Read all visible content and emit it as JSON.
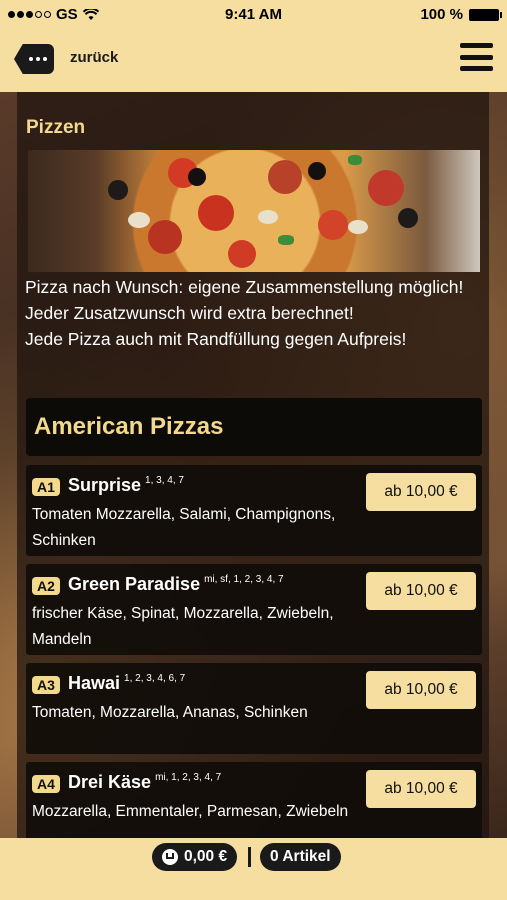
{
  "status": {
    "carrier": "GS",
    "time": "9:41 AM",
    "battery": "100 %"
  },
  "header": {
    "back_label": "zurück"
  },
  "section": {
    "title": "Pizzen",
    "intro": [
      "Pizza nach Wunsch: eigene Zusammenstellung möglich!",
      "Jeder Zusatzwunsch wird extra berechnet!",
      "Jede Pizza auch mit Randfüllung gegen Aufpreis!"
    ]
  },
  "category": {
    "title": "American Pizzas"
  },
  "items": [
    {
      "code": "A1",
      "name": "Surprise",
      "notes": "1, 3, 4, 7",
      "desc": "Tomaten Mozzarella, Salami, Champignons, Schinken",
      "price": "ab 10,00 €"
    },
    {
      "code": "A2",
      "name": "Green Paradise",
      "notes": "mi, sf, 1, 2, 3, 4, 7",
      "desc": "frischer Käse, Spinat, Mozzarella, Zwiebeln, Mandeln",
      "price": "ab 10,00 €"
    },
    {
      "code": "A3",
      "name": "Hawai",
      "notes": "1, 2, 3, 4, 6, 7",
      "desc": "Tomaten, Mozzarella, Ananas, Schinken",
      "price": "ab 10,00 €"
    },
    {
      "code": "A4",
      "name": "Drei Käse",
      "notes": "mi, 1, 2, 3, 4, 7",
      "desc": "Mozzarella, Emmentaler, Parmesan, Zwiebeln",
      "price": "ab 10,00 €"
    }
  ],
  "footer": {
    "total": "0,00 €",
    "count": "0 Artikel"
  }
}
